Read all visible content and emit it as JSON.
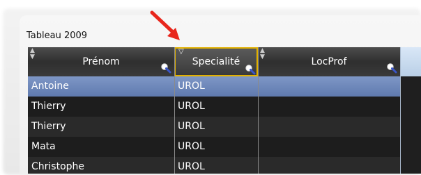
{
  "panel": {
    "title": "Tableau 2009"
  },
  "table": {
    "columns": [
      {
        "label": "Prénom"
      },
      {
        "label": "Specialité"
      },
      {
        "label": "LocProf"
      }
    ],
    "rows": [
      {
        "prenom": "Antoine",
        "specialite": "UROL",
        "selected": true
      },
      {
        "prenom": "Thierry",
        "specialite": "UROL"
      },
      {
        "prenom": "Thierry",
        "specialite": "UROL"
      },
      {
        "prenom": "Mata",
        "specialite": "UROL"
      },
      {
        "prenom": "Christophe",
        "specialite": "UROL"
      }
    ]
  },
  "colors": {
    "accent_arrow": "#e8261c",
    "selection": "#6f88bb",
    "header_highlight": "#e2b100"
  }
}
